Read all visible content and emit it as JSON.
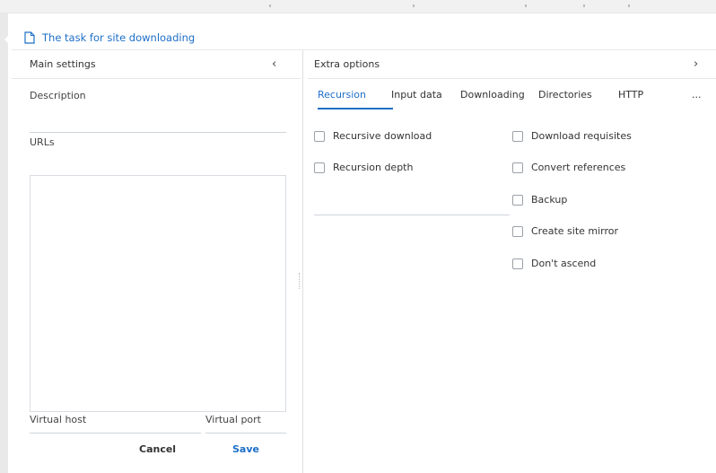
{
  "window": {
    "title": "The task for site downloading"
  },
  "main_settings": {
    "header": "Main settings",
    "description_label": "Description",
    "urls_label": "URLs",
    "virtual_host_label": "Virtual host",
    "virtual_port_label": "Virtual port",
    "cancel_label": "Cancel",
    "save_label": "Save"
  },
  "extra_options": {
    "header": "Extra options",
    "tabs": [
      "Recursion",
      "Input data",
      "Downloading",
      "Directories",
      "HTTP",
      "..."
    ],
    "active_tab": "Recursion",
    "left_options": [
      {
        "label": "Recursive download",
        "checked": false
      },
      {
        "label": "Recursion depth",
        "checked": false
      }
    ],
    "right_options": [
      {
        "label": "Download requisites",
        "checked": false
      },
      {
        "label": "Convert references",
        "checked": false
      },
      {
        "label": "Backup",
        "checked": false
      },
      {
        "label": "Create site mirror",
        "checked": false
      },
      {
        "label": "Don't ascend",
        "checked": false
      }
    ]
  },
  "colors": {
    "accent": "#1e6fc8",
    "border": "#d8dde2"
  },
  "icons": [
    "document-icon",
    "collapse-left-icon",
    "expand-right-icon"
  ]
}
